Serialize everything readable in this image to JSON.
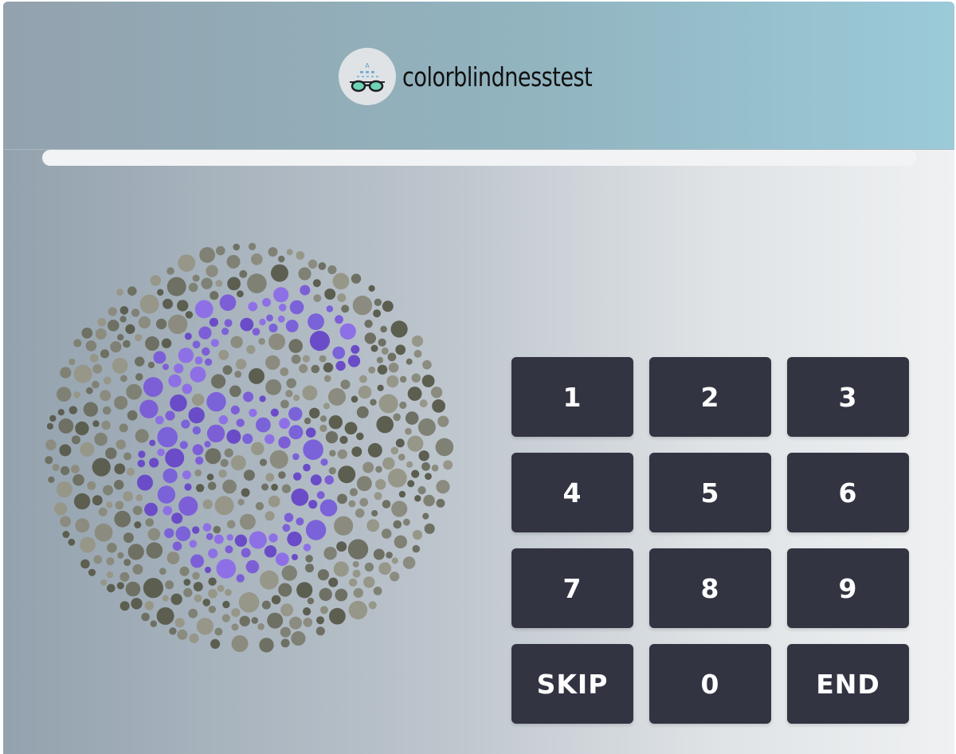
{
  "header": {
    "brand_name": "colorblindnesstest",
    "logo_icon": "eye-chart-glasses-icon"
  },
  "progress": {
    "value": 0
  },
  "plate": {
    "type": "ishihara-color-plate",
    "background_colors": [
      "#5c5e50",
      "#6e7063",
      "#7f8174",
      "#8b8c7f",
      "#969789"
    ],
    "figure_colors": [
      "#6a4cc8",
      "#7c5fd6",
      "#8e70e6",
      "#7a62d9"
    ]
  },
  "keypad": {
    "keys": [
      {
        "label": "1"
      },
      {
        "label": "2"
      },
      {
        "label": "3"
      },
      {
        "label": "4"
      },
      {
        "label": "5"
      },
      {
        "label": "6"
      },
      {
        "label": "7"
      },
      {
        "label": "8"
      },
      {
        "label": "9"
      },
      {
        "label": "SKIP"
      },
      {
        "label": "0"
      },
      {
        "label": "END"
      }
    ]
  },
  "colors": {
    "key_background": "#323442",
    "key_text": "#ffffff",
    "progress_track": "#f2f3f4"
  }
}
